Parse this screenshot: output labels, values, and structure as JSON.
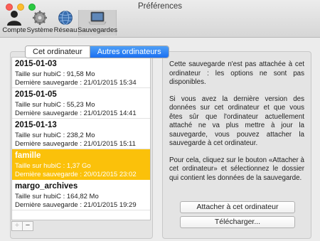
{
  "window": {
    "title": "Préférences"
  },
  "toolbar": {
    "items": [
      {
        "label": "Compte",
        "icon": "person-icon"
      },
      {
        "label": "Système",
        "icon": "gear-icon"
      },
      {
        "label": "Réseau",
        "icon": "globe-icon"
      },
      {
        "label": "Sauvegardes",
        "icon": "laptop-icon",
        "selected": true
      }
    ]
  },
  "tabs": [
    {
      "label": "Cet ordinateur",
      "active": false
    },
    {
      "label": "Autres ordinateurs",
      "active": true
    }
  ],
  "backups": [
    {
      "name": "2015-01-03",
      "size": "Taille sur hubiC : 91,58 Mo",
      "last": "Dernière sauvegarde : 21/01/2015 15:34",
      "selected": false
    },
    {
      "name": "2015-01-05",
      "size": "Taille sur hubiC : 55,23 Mo",
      "last": "Dernière sauvegarde : 21/01/2015 14:41",
      "selected": false
    },
    {
      "name": "2015-01-13",
      "size": "Taille sur hubiC : 238,2 Mo",
      "last": "Dernière sauvegarde : 21/01/2015 15:11",
      "selected": false
    },
    {
      "name": "famille",
      "size": "Taille sur hubiC : 1,37 Go",
      "last": "Dernière sauvegarde : 20/01/2015 23:02",
      "selected": true
    },
    {
      "name": "margo_archives",
      "size": "Taille sur hubiC : 164,82 Mo",
      "last": "Dernière sauvegarde : 21/01/2015 19:29",
      "selected": false
    }
  ],
  "list_controls": {
    "add": "+",
    "remove": "−"
  },
  "detail": {
    "paragraphs": [
      "Cette sauvegarde n'est pas attachée à cet ordinateur : les options ne sont pas disponibles.",
      "Si vous avez la dernière version des données sur cet ordinateur et que vous êtes sûr que l'ordinateur actuellement attaché ne va plus mettre à jour la sauvegarde, vous pouvez attacher la sauvegarde à cet ordinateur.",
      "Pour cela, cliquez sur le bouton «Attacher à cet ordinateur» et sélectionnez le dossier qui contient les données de la sauvegarde."
    ],
    "attach_button": "Attacher à cet ordinateur",
    "download_button": "Télécharger..."
  },
  "colors": {
    "selection": "#fbc10a",
    "tab_active": "#1b6ff1"
  }
}
